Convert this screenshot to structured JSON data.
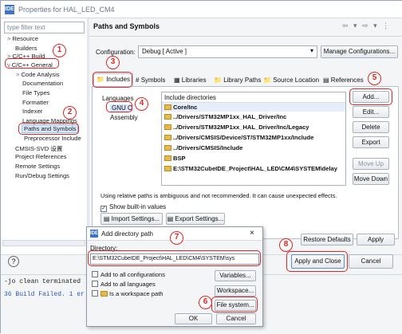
{
  "window": {
    "title": "Properties for HAL_LED_CM4",
    "icon": "IDE"
  },
  "left_panel": {
    "filter_placeholder": "type filter text",
    "tree": [
      {
        "label": "Resource",
        "arrow": ">"
      },
      {
        "label": "Builders",
        "arrow": ""
      },
      {
        "label": "C/C++ Build",
        "arrow": ">"
      },
      {
        "label": "C/C++ General",
        "arrow": "v"
      },
      {
        "label": "Code Analysis",
        "arrow": ">"
      },
      {
        "label": "Documentation",
        "arrow": ""
      },
      {
        "label": "File Types",
        "arrow": ""
      },
      {
        "label": "Formatter",
        "arrow": ""
      },
      {
        "label": "Indexer",
        "arrow": ""
      },
      {
        "label": "Language Mappings",
        "arrow": ""
      },
      {
        "label": "Paths and Symbols",
        "arrow": ""
      },
      {
        "label": "Preprocessor Include",
        "arrow": ""
      },
      {
        "label": "CMSIS-SVD 设置",
        "arrow": ""
      },
      {
        "label": "Project References",
        "arrow": ""
      },
      {
        "label": "Remote Settings",
        "arrow": ""
      },
      {
        "label": "Run/Debug Settings",
        "arrow": ""
      }
    ]
  },
  "right_panel": {
    "title": "Paths and Symbols",
    "nav_icons": "⇦ ▾ ⇨ ▾ ⋮",
    "configuration_label": "Configuration:",
    "configuration_value": "Debug  [ Active ]",
    "manage_button": "Manage Configurations...",
    "tabs": [
      "Includes",
      "Symbols",
      "Libraries",
      "Library Paths",
      "Source Location",
      "References"
    ],
    "tab_icons": [
      "📁",
      "#",
      "▦",
      "📁",
      "📁",
      "▤"
    ],
    "languages_header": "Languages",
    "languages": [
      "GNU C",
      "Assembly"
    ],
    "include_header": "Include directories",
    "include_dirs": [
      "Core/Inc",
      "../Drivers/STM32MP1xx_HAL_Driver/Inc",
      "../Drivers/STM32MP1xx_HAL_Driver/Inc/Legacy",
      "../Drivers/CMSIS/Device/ST/STM32MP1xx/Include",
      "../Drivers/CMSIS/Include",
      "BSP",
      "E:\\STM32CubeIDE_Project\\HAL_LED\\CM4\\SYSTEM\\delay"
    ],
    "side_buttons": [
      "Add...",
      "Edit...",
      "Delete",
      "Export",
      "Move Up",
      "Move Down"
    ],
    "relative_note": "Using relative paths is ambiguous and not recommended. It can cause unexpected effects.",
    "show_builtin": "Show built-in values",
    "import_button": "Import Settings...",
    "export_button": "Export Settings...",
    "restore_button": "Restore Defaults",
    "apply_button": "Apply"
  },
  "bottom": {
    "help_icon": "?",
    "apply_close_button": "Apply and Close",
    "cancel_button": "Cancel",
    "console_line1": "-jo clean  terminated",
    "console_line2": "36 Build Failed. 1 er"
  },
  "dialog": {
    "title": "Add directory path",
    "directory_label": "Directory:",
    "directory_value": "E:\\STM32CubeIDE_Project\\HAL_LED\\CM4\\SYSTEM\\sys",
    "add_all_configs": "Add to all configurations",
    "add_all_langs": "Add to all languages",
    "workspace_path": "Is a workspace path",
    "variables_button": "Variables...",
    "workspace_button": "Workspace...",
    "filesystem_button": "File system...",
    "ok_button": "OK",
    "cancel_button": "Cancel"
  },
  "annotations": [
    "1",
    "2",
    "3",
    "4",
    "5",
    "6",
    "7",
    "8"
  ],
  "colors": {
    "annotation": "#e02424",
    "selection": "#d7e6fa"
  }
}
